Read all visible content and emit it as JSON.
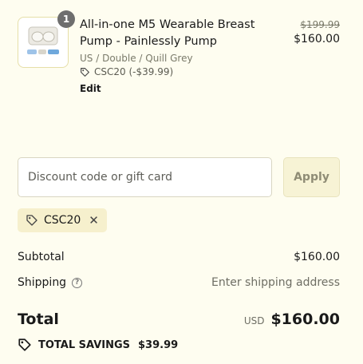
{
  "product": {
    "quantity": "1",
    "title": "All-in-one M5 Wearable Breast Pump - Painlessly Pump",
    "variant": "US / Double / Quill Grey",
    "discount_label": "CSC20 (-$39.99)",
    "edit_label": "Edit",
    "price_original": "$199.99",
    "price_current": "$160.00"
  },
  "discount_form": {
    "placeholder": "Discount code or gift card",
    "apply_label": "Apply",
    "applied_code": "CSC20"
  },
  "summary": {
    "subtotal_label": "Subtotal",
    "subtotal_value": "$160.00",
    "shipping_label": "Shipping",
    "shipping_value": "Enter shipping address",
    "total_label": "Total",
    "currency": "USD",
    "total_value": "$160.00",
    "savings_label": "TOTAL SAVINGS",
    "savings_value": "$39.99"
  },
  "icons": {
    "tag": "tag-icon",
    "remove": "close-icon",
    "help": "help-icon"
  },
  "colors": {
    "background": "#fefdf0",
    "chip_background": "#f6f0cd",
    "apply_background": "#f7f3d5"
  }
}
